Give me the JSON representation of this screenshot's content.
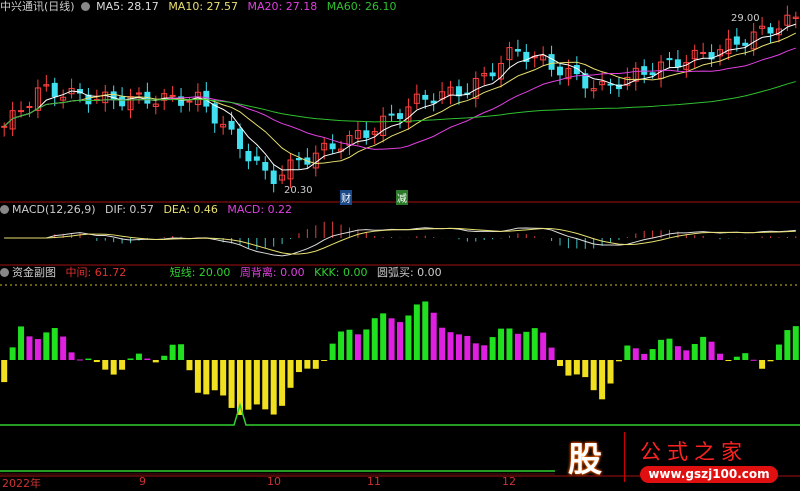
{
  "main": {
    "title": "中兴通讯(日线)",
    "ma5": "MA5: 28.17",
    "ma10": "MA10: 27.57",
    "ma20": "MA20: 27.18",
    "ma60": "MA60: 26.10",
    "high_label": "29.00",
    "low_label": "20.30",
    "tag_cai": "财",
    "tag_jian": "减"
  },
  "macd": {
    "title": "MACD(12,26,9)",
    "dif": "DIF: 0.57",
    "dea": "DEA: 0.46",
    "macd": "MACD: 0.22"
  },
  "fund": {
    "title": "资金副图",
    "mid": "中间: 61.72",
    "short": "短线: 20.00",
    "zhou": "周背离: 0.00",
    "kkk": "KKK: 0.00",
    "yuan": "圆弧买: 0.00"
  },
  "xaxis": [
    "2022年",
    "9",
    "10",
    "11",
    "12"
  ],
  "watermark": {
    "char": "股",
    "name": "公式之家",
    "url": "www.gszj100.com"
  },
  "chart_data": {
    "type": "candlestick",
    "price_keypoints": [
      [
        0,
        23.3
      ],
      [
        40,
        25.4
      ],
      [
        100,
        24.9
      ],
      [
        200,
        24.9
      ],
      [
        270,
        20.8
      ],
      [
        300,
        21.8
      ],
      [
        370,
        23.3
      ],
      [
        420,
        24.9
      ],
      [
        470,
        25.4
      ],
      [
        515,
        27.4
      ],
      [
        560,
        26.4
      ],
      [
        600,
        25.4
      ],
      [
        650,
        26.4
      ],
      [
        720,
        27.4
      ],
      [
        790,
        28.9
      ]
    ],
    "fund_keypoints": [
      [
        0,
        -0.6
      ],
      [
        20,
        0.5
      ],
      [
        60,
        0.4
      ],
      [
        100,
        -0.2
      ],
      [
        180,
        0.2
      ],
      [
        200,
        -0.5
      ],
      [
        240,
        -0.8
      ],
      [
        270,
        -0.9
      ],
      [
        300,
        -0.3
      ],
      [
        350,
        0.5
      ],
      [
        430,
        0.9
      ],
      [
        460,
        0.3
      ],
      [
        500,
        0.4
      ],
      [
        530,
        0.6
      ],
      [
        570,
        -0.2
      ],
      [
        600,
        -0.6
      ],
      [
        630,
        0.2
      ],
      [
        700,
        0.3
      ],
      [
        760,
        -0.1
      ],
      [
        800,
        0.6
      ]
    ],
    "colors": {
      "up": "#ff4040",
      "down": "#40e0f0",
      "ma5": "#ffffff",
      "ma10": "#e8e070",
      "ma20": "#e040e0",
      "ma60": "#30c030"
    }
  }
}
